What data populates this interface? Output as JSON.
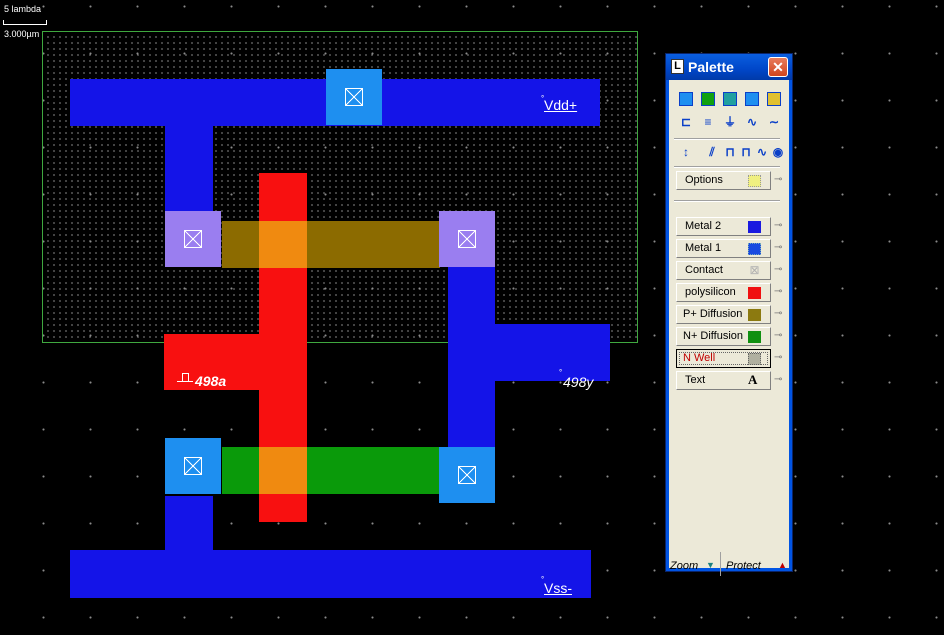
{
  "scale": {
    "top_label": "5 lambda",
    "bottom_label": "3.000µm"
  },
  "labels": {
    "vdd": "Vdd+",
    "vss": "Vss-",
    "input": "498a",
    "output": "498y"
  },
  "colors": {
    "metal1": "#1414e8",
    "metal2": "#1212d0",
    "poly": "#f81010",
    "pdiff": "#8c6b00",
    "ndiff": "#0a9a0a",
    "contact_m1": "#1e8ff0",
    "contact_pd": "#9a7ef0",
    "nwell_border": "#3fa83f"
  },
  "palette": {
    "title": "Palette",
    "close": "✕",
    "app_icon": "L",
    "tool_rows": [
      [
        "metal-contact-icon",
        "nwell-contact-icon",
        "pwell-contact-icon",
        "via-icon",
        "layer-grid-icon"
      ],
      [
        "pad-icon",
        "stack-icon",
        "ground-icon",
        "resistor-icon",
        "wave-icon"
      ],
      [
        "updown-arrow-icon",
        "antenna-icon",
        "pulse-icon",
        "square-wave-icon",
        "eye-icon"
      ]
    ],
    "options_label": "Options",
    "layers": [
      {
        "name": "Metal 2",
        "color": "#1a1ae0"
      },
      {
        "name": "Metal 1",
        "color": "#1a4ae0"
      },
      {
        "name": "Contact",
        "color": "#c0c0c0"
      },
      {
        "name": "polysilicon",
        "color": "#f01010"
      },
      {
        "name": "P+ Diffusion",
        "color": "#8c7a10"
      },
      {
        "name": "N+ Diffusion",
        "color": "#109010"
      },
      {
        "name": "N Well",
        "color": "#b0b0a0"
      },
      {
        "name": "Text",
        "color": "#000000"
      }
    ],
    "text_glyph": "A",
    "zoom_label": "Zoom",
    "protect_label": "Protect"
  }
}
